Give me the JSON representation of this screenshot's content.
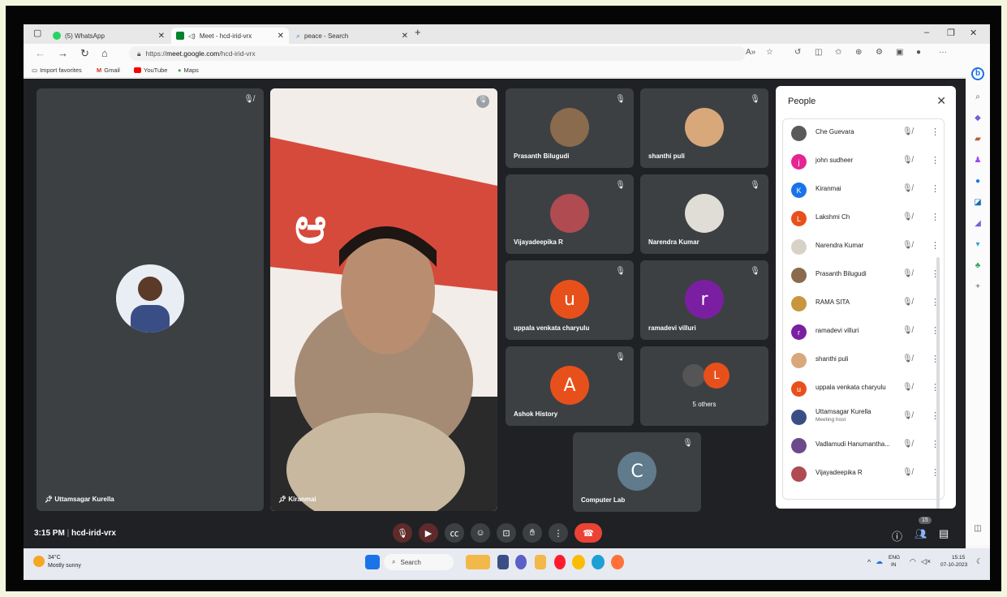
{
  "browser": {
    "tabs": [
      {
        "label": "(5) WhatsApp"
      },
      {
        "label": "Meet - hcd-irid-vrx"
      },
      {
        "label": "peace - Search"
      }
    ],
    "url_prefix": "https://",
    "url_domain": "meet.google.com",
    "url_path": "/hcd-irid-vrx",
    "favorites": [
      "Import favorites",
      "Gmail",
      "YouTube",
      "Maps"
    ]
  },
  "meet": {
    "main_tiles": [
      {
        "name": "Uttamsagar Kurella"
      },
      {
        "name": "Kiranmai"
      }
    ],
    "tiles": [
      {
        "name": "Prasanth Bilugudi"
      },
      {
        "name": "shanthi puli"
      },
      {
        "name": "Vijayadeepika R"
      },
      {
        "name": "Narendra Kumar"
      },
      {
        "name": "uppala venkata charyulu",
        "letter": "u"
      },
      {
        "name": "ramadevi villuri",
        "letter": "r"
      },
      {
        "name": "Ashok History",
        "letter": "A"
      },
      {
        "name": "5 others",
        "letter": "L"
      },
      {
        "name": "Computer Lab",
        "letter": "C"
      }
    ],
    "time": "3:15 PM",
    "separator": "|",
    "meeting_code": "hcd-irid-vrx",
    "participant_count": "15"
  },
  "people": {
    "title": "People",
    "list": [
      {
        "name": "Che Guevara",
        "initial": ""
      },
      {
        "name": "john sudheer",
        "initial": "j"
      },
      {
        "name": "Kiranmai",
        "initial": "K"
      },
      {
        "name": "Lakshmi Ch",
        "initial": "L"
      },
      {
        "name": "Narendra Kumar",
        "initial": ""
      },
      {
        "name": "Prasanth Bilugudi",
        "initial": ""
      },
      {
        "name": "RAMA SITA",
        "initial": ""
      },
      {
        "name": "ramadevi villuri",
        "initial": "r"
      },
      {
        "name": "shanthi puli",
        "initial": ""
      },
      {
        "name": "uppala venkata charyulu",
        "initial": "u"
      },
      {
        "name": "Uttamsagar Kurella",
        "initial": "",
        "sub": "Meeting host"
      },
      {
        "name": "Vadlamudi Hanumantha...",
        "initial": ""
      },
      {
        "name": "Vijayadeepika R",
        "initial": ""
      }
    ]
  },
  "taskbar": {
    "weather_temp": "34°C",
    "weather_desc": "Mostly sunny",
    "search": "Search",
    "lang": "ENG",
    "region": "IN",
    "time": "15:15",
    "date": "07-10-2023"
  },
  "colors": {
    "meet_bg": "#202124",
    "tile_bg": "#3c4043",
    "end_call": "#ea4335"
  }
}
